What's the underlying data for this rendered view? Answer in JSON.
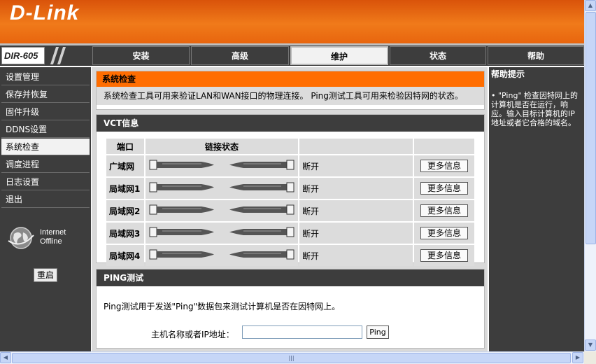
{
  "brand": {
    "logo_text": "D-Link",
    "model": "DIR-605",
    "color_orange": "#ff6d00",
    "color_dark": "#3d3d3d"
  },
  "nav": {
    "tabs": [
      {
        "label": "安装",
        "active": false
      },
      {
        "label": "高级",
        "active": false
      },
      {
        "label": "维护",
        "active": true
      },
      {
        "label": "状态",
        "active": false
      },
      {
        "label": "帮助",
        "active": false
      }
    ]
  },
  "sidebar": {
    "items": [
      {
        "label": "设置管理",
        "active": false
      },
      {
        "label": "保存并恢复",
        "active": false
      },
      {
        "label": "固件升级",
        "active": false
      },
      {
        "label": "DDNS设置",
        "active": false
      },
      {
        "label": "系统检查",
        "active": true
      },
      {
        "label": "调度进程",
        "active": false
      },
      {
        "label": "日志设置",
        "active": false
      },
      {
        "label": "退出",
        "active": false
      }
    ],
    "status_line1": "Internet",
    "status_line2": "Offline",
    "status_icon": "globe-icon",
    "reboot_label": "重启"
  },
  "system_check": {
    "title": "系统检查",
    "description": "系统检查工具可用来验证LAN和WAN接口的物理连接。 Ping测试工具可用来检验因特网的状态。"
  },
  "vct": {
    "title": "VCT信息",
    "col_port": "端口",
    "col_link": "链接状态",
    "rows": [
      {
        "port": "广域网",
        "status": "断开",
        "button": "更多信息"
      },
      {
        "port": "局域网1",
        "status": "断开",
        "button": "更多信息"
      },
      {
        "port": "局域网2",
        "status": "断开",
        "button": "更多信息"
      },
      {
        "port": "局域网3",
        "status": "断开",
        "button": "更多信息"
      },
      {
        "port": "局域网4",
        "status": "断开",
        "button": "更多信息"
      }
    ]
  },
  "ping": {
    "title": "PING测试",
    "description": "Ping测试用于发送\"Ping\"数据包来测试计算机是否在因特网上。",
    "host_label": "主机名称或者IP地址：",
    "input_value": "",
    "button_label": "Ping"
  },
  "help": {
    "title": "帮助提示",
    "text": "• \"Ping\" 检查因特网上的计算机是否在运行，响应。输入目标计算机的IP地址或者它合格的域名。"
  }
}
